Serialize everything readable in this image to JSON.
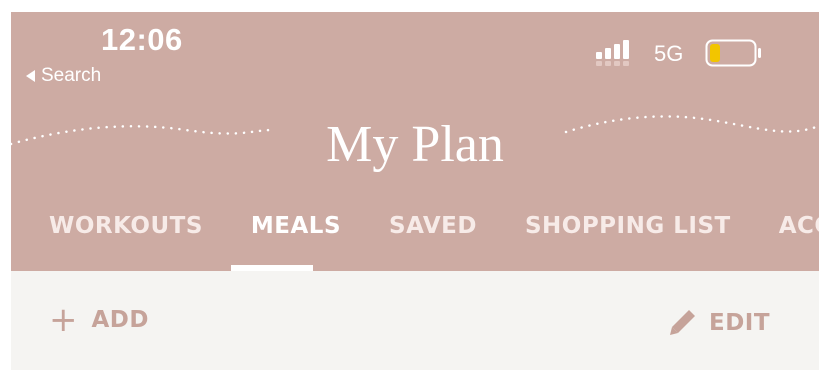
{
  "status_bar": {
    "time": "12:06",
    "back_label": "Search",
    "network": "5G",
    "battery_color": "#f2c500"
  },
  "header": {
    "title": "My Plan",
    "background_color": "#cdaba3"
  },
  "tabs": [
    {
      "label": "WORKOUTS",
      "active": false
    },
    {
      "label": "MEALS",
      "active": true
    },
    {
      "label": "SAVED",
      "active": false
    },
    {
      "label": "SHOPPING LIST",
      "active": false
    },
    {
      "label": "ACCOUNT",
      "active": false
    }
  ],
  "toolbar": {
    "add_icon": "plus-icon",
    "add_label": "ADD",
    "edit_icon": "pencil-icon",
    "edit_label": "EDIT",
    "accent_color": "#c6a39a"
  }
}
